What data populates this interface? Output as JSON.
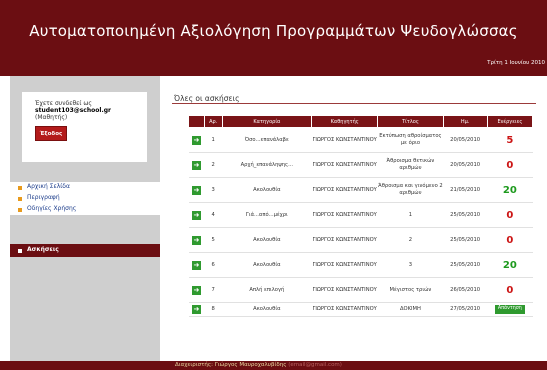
{
  "header": {
    "title": "Αυτοματοποιημένη Αξιολόγηση Προγραμμάτων Ψευδογλώσσας",
    "date": "Τρίτη 1 Ιουνίου 2010"
  },
  "login": {
    "line1": "Έχετε συνδεθεί ως",
    "username": "student103@school.gr",
    "role": "(Μαθητής)",
    "logout_label": "Έξοδος"
  },
  "menu": {
    "items": [
      {
        "label": "Αρχική Σελίδα"
      },
      {
        "label": "Περιγραφή"
      },
      {
        "label": "Οδηγίες Χρήσης"
      }
    ],
    "active": {
      "label": "Ασκήσεις"
    }
  },
  "section": {
    "title": "Όλες οι ασκήσεις"
  },
  "table": {
    "headers": [
      "Αρ.",
      "Κατηγορία",
      "Καθηγητής",
      "Τίτλος",
      "Ημ.",
      "Ενέργειες"
    ],
    "rows": [
      {
        "num": "1",
        "category": "Όσο...επανάλαβε",
        "teacher": "ΓΙΩΡΓΟΣ ΚΩΝΣΤΑΝΤΙΝΟΥ",
        "title": "Εκτύπωση αθροίσματος με όριο",
        "date": "20/05/2010",
        "action": "5",
        "action_type": "score-red"
      },
      {
        "num": "2",
        "category": "Αρχή_επανάληψης...",
        "teacher": "ΓΙΩΡΓΟΣ ΚΩΝΣΤΑΝΤΙΝΟΥ",
        "title": "Άθροισμα θετικών αριθμών",
        "date": "20/05/2010",
        "action": "0",
        "action_type": "score-red"
      },
      {
        "num": "3",
        "category": "Ακολουθία",
        "teacher": "ΓΙΩΡΓΟΣ ΚΩΝΣΤΑΝΤΙΝΟΥ",
        "title": "Άθροισμα και γινόμενο 2 αριθμών",
        "date": "21/05/2010",
        "action": "20",
        "action_type": "score-green"
      },
      {
        "num": "4",
        "category": "Γιά...από...μέχρι",
        "teacher": "ΓΙΩΡΓΟΣ ΚΩΝΣΤΑΝΤΙΝΟΥ",
        "title": "1",
        "date": "25/05/2010",
        "action": "0",
        "action_type": "score-red"
      },
      {
        "num": "5",
        "category": "Ακολουθία",
        "teacher": "ΓΙΩΡΓΟΣ ΚΩΝΣΤΑΝΤΙΝΟΥ",
        "title": "2",
        "date": "25/05/2010",
        "action": "0",
        "action_type": "score-red"
      },
      {
        "num": "6",
        "category": "Ακολουθία",
        "teacher": "ΓΙΩΡΓΟΣ ΚΩΝΣΤΑΝΤΙΝΟΥ",
        "title": "3",
        "date": "25/05/2010",
        "action": "20",
        "action_type": "score-green"
      },
      {
        "num": "7",
        "category": "Απλή επιλογή",
        "teacher": "ΓΙΩΡΓΟΣ ΚΩΝΣΤΑΝΤΙΝΟΥ",
        "title": "Μέγιστος τριών",
        "date": "26/05/2010",
        "action": "0",
        "action_type": "score-red"
      },
      {
        "num": "8",
        "category": "Ακολουθία",
        "teacher": "ΓΙΩΡΓΟΣ ΚΩΝΣΤΑΝΤΙΝΟΥ",
        "title": "ΔΟΚΙΜΗ",
        "date": "27/05/2010",
        "action": "Απάντηση",
        "action_type": "button"
      }
    ]
  },
  "footer": {
    "text": "Διαχειριστής: Γιώργος Μαυροχαλυβίδης",
    "email": "(email@gmail.com)"
  },
  "colors": {
    "brand": "#6b0e12",
    "accent": "#e89a1c",
    "success": "#2f9a2f",
    "error": "#cc1414"
  },
  "icons": {
    "row_arrow": "arrow-right-icon",
    "menu_bullet": "square-bullet-icon"
  }
}
